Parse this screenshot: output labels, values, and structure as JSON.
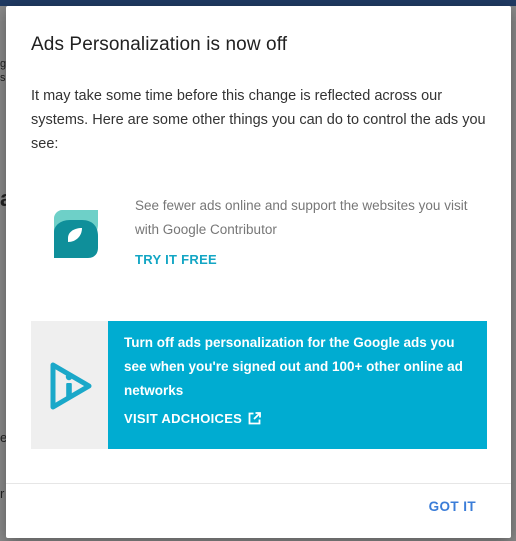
{
  "dialog": {
    "title": "Ads Personalization is now off",
    "intro": "It may take some time before this change is reflected across our systems. Here are some other things you can do to control the ads you see:",
    "contributor": {
      "icon": "google-contributor-logo",
      "description": "See fewer ads online and support the websites you visit with Google Contributor",
      "link_label": "TRY IT FREE",
      "accent_color": "#13a6c4"
    },
    "adchoices": {
      "icon": "adchoices-logo",
      "description": "Turn off ads personalization for the Google ads you see when you're signed out and 100+ other online ad networks",
      "link_label": "VISIT ADCHOICES",
      "link_icon": "external-link-icon",
      "background_color": "#00acd1"
    },
    "footer": {
      "button_label": "GOT IT",
      "button_color": "#3b7dd8"
    }
  }
}
